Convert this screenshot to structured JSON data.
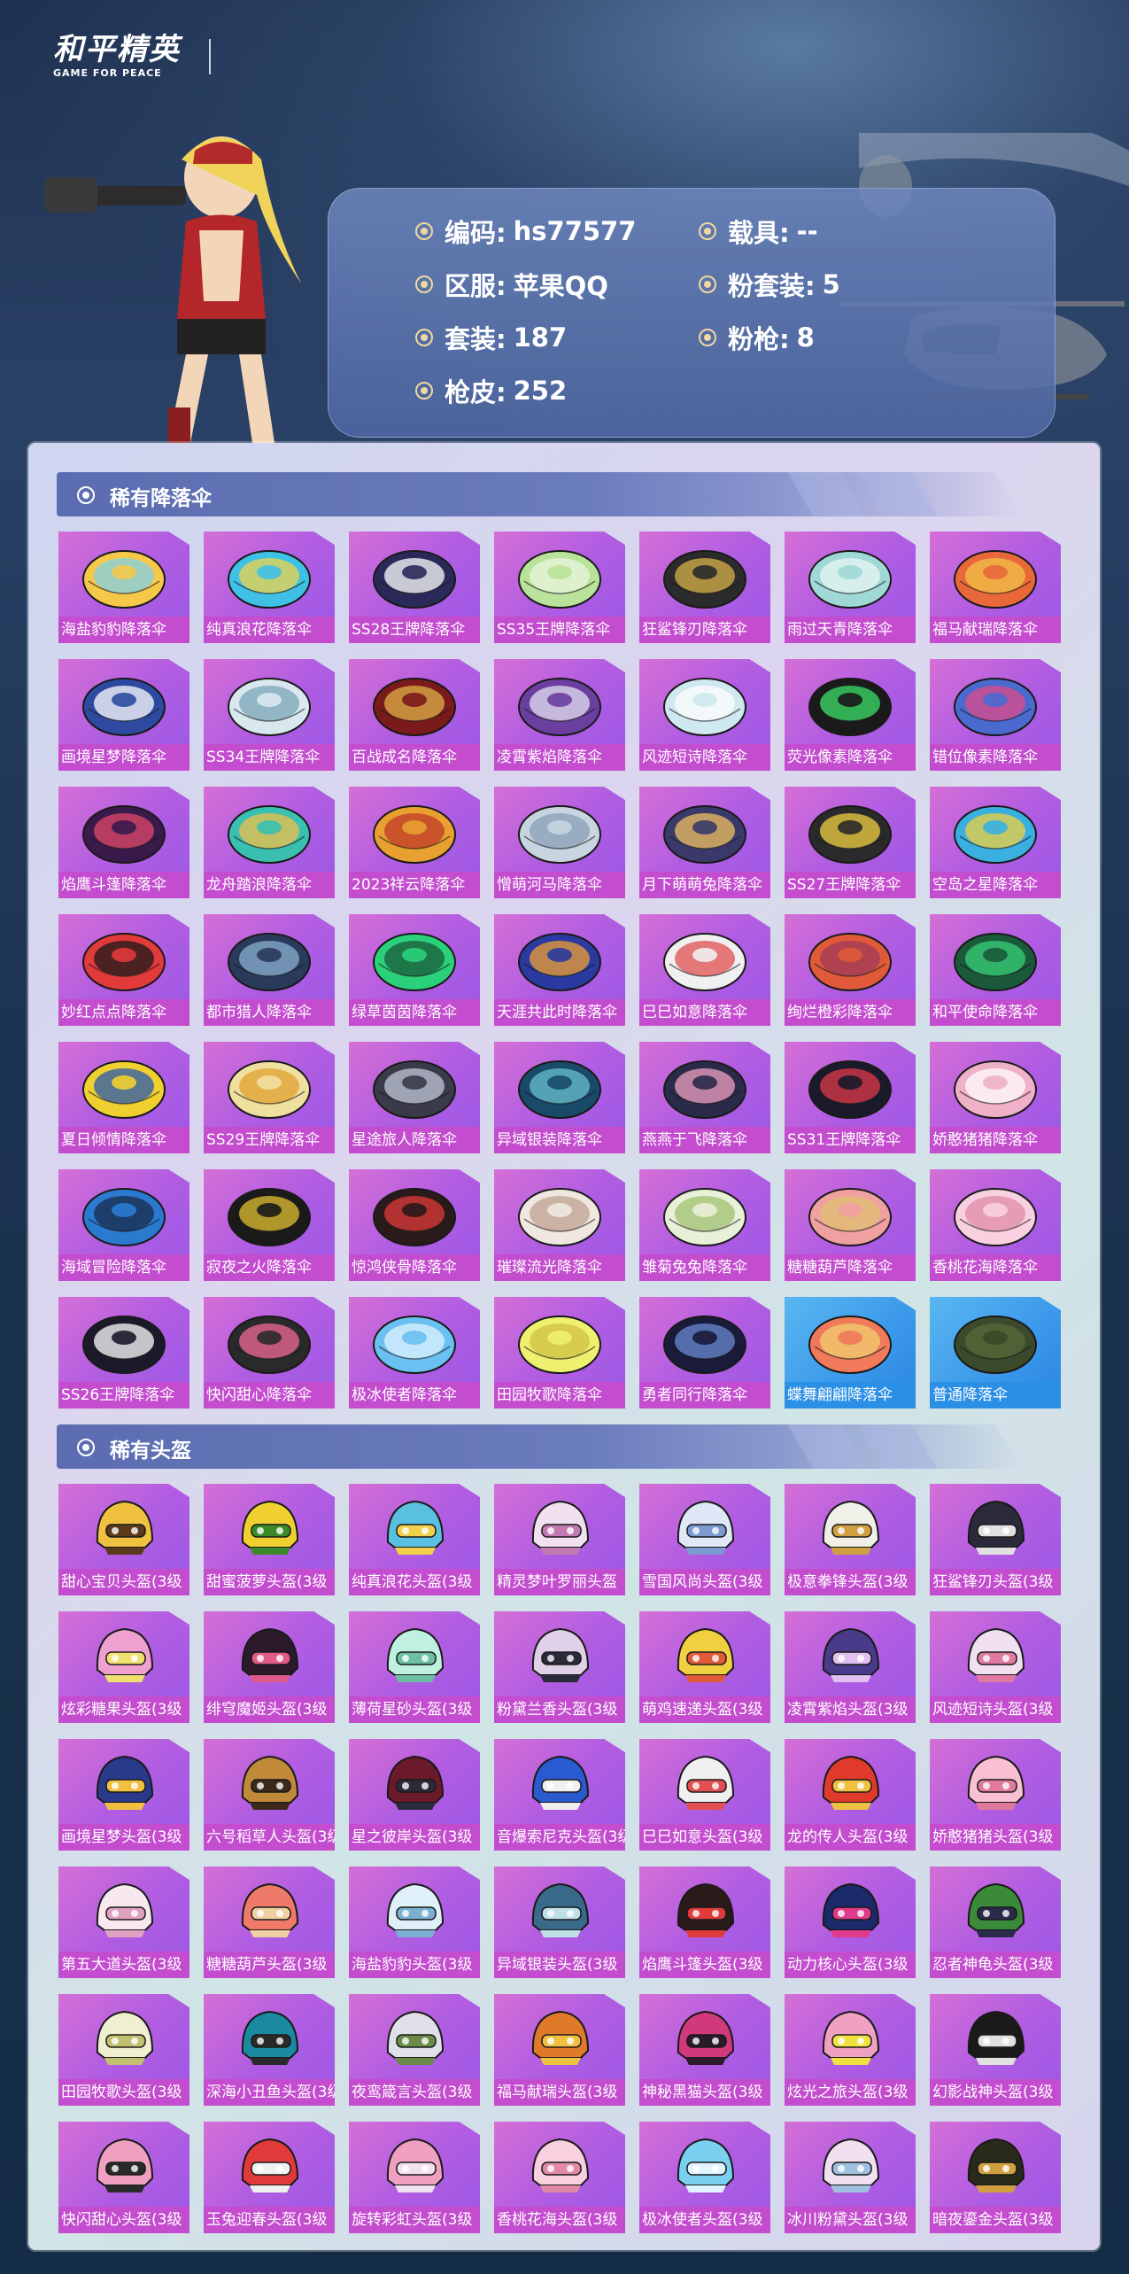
{
  "header": {
    "logo_cn": "和平精英",
    "logo_en": "GAME FOR PEACE"
  },
  "info": {
    "code_label": "编码:",
    "code_value": "hs77577",
    "vehicle_label": "载具:",
    "vehicle_value": "--",
    "server_label": "区服:",
    "server_value": "苹果QQ",
    "pink_suit_label": "粉套装:",
    "pink_suit_value": "5",
    "suit_label": "套装:",
    "suit_value": "187",
    "pink_gun_label": "粉枪:",
    "pink_gun_value": "8",
    "gun_skin_label": "枪皮:",
    "gun_skin_value": "252"
  },
  "colors": {
    "card_purple": "#b15de2",
    "card_label_purple": "#c44dcf",
    "card_blue": "#3a97ea",
    "section_bar": "#5b6cb0"
  },
  "sections": {
    "parachutes": {
      "title": "稀有降落伞",
      "items": [
        {
          "name": "海盐豹豹降落伞",
          "c1": "#f5c84a",
          "c2": "#7fd0e8"
        },
        {
          "name": "纯真浪花降落伞",
          "c1": "#3fc1e6",
          "c2": "#f0d34a"
        },
        {
          "name": "SS28王牌降落伞",
          "c1": "#2a2a5a",
          "c2": "#ffffff"
        },
        {
          "name": "SS35王牌降落伞",
          "c1": "#b9e39a",
          "c2": "#e9f5e0"
        },
        {
          "name": "狂鲨锋刃降落伞",
          "c1": "#2b2b2b",
          "c2": "#d8b24a"
        },
        {
          "name": "雨过天青降落伞",
          "c1": "#9fd8d6",
          "c2": "#e8f5f3"
        },
        {
          "name": "福马献瑞降落伞",
          "c1": "#e8683a",
          "c2": "#f3c14a"
        },
        {
          "name": "画境星梦降落伞",
          "c1": "#2d4aa0",
          "c2": "#ffffff"
        },
        {
          "name": "SS34王牌降落伞",
          "c1": "#d9e8ee",
          "c2": "#7aa6b7"
        },
        {
          "name": "百战成名降落伞",
          "c1": "#7a1a1a",
          "c2": "#e0b048"
        },
        {
          "name": "凌霄紫焰降落伞",
          "c1": "#6a3fa0",
          "c2": "#e6e0f0"
        },
        {
          "name": "风迹短诗降落伞",
          "c1": "#d0e8f0",
          "c2": "#ffffff"
        },
        {
          "name": "荧光像素降落伞",
          "c1": "#1a1a1a",
          "c2": "#3de06a"
        },
        {
          "name": "错位像素降落伞",
          "c1": "#4a6ad0",
          "c2": "#e04a8a"
        },
        {
          "name": "焰鹰斗篷降落伞",
          "c1": "#3a1a4a",
          "c2": "#e04a6a"
        },
        {
          "name": "龙舟踏浪降落伞",
          "c1": "#3ac0b0",
          "c2": "#f0c04a"
        },
        {
          "name": "2023祥云降落伞",
          "c1": "#e8a030",
          "c2": "#c03a2a"
        },
        {
          "name": "憎萌河马降落伞",
          "c1": "#c8d4e0",
          "c2": "#8aa0b8"
        },
        {
          "name": "月下萌萌兔降落伞",
          "c1": "#3a3a6a",
          "c2": "#f0c060"
        },
        {
          "name": "SS27王牌降落伞",
          "c1": "#2a2a2a",
          "c2": "#f0d040"
        },
        {
          "name": "空岛之星降落伞",
          "c1": "#3ab0e0",
          "c2": "#f0d040"
        },
        {
          "name": "妙红点点降落伞",
          "c1": "#e03a3a",
          "c2": "#1a1a1a"
        },
        {
          "name": "都市猎人降落伞",
          "c1": "#2a3a5a",
          "c2": "#8ab0d0"
        },
        {
          "name": "绿草茵茵降落伞",
          "c1": "#2ad07a",
          "c2": "#1a5a3a"
        },
        {
          "name": "天涯共此时降落伞",
          "c1": "#2a3aa0",
          "c2": "#f0a030"
        },
        {
          "name": "巳巳如意降落伞",
          "c1": "#f0f0f0",
          "c2": "#e05050"
        },
        {
          "name": "绚烂橙彩降落伞",
          "c1": "#e05a3a",
          "c2": "#a03a5a"
        },
        {
          "name": "和平使命降落伞",
          "c1": "#1a5a3a",
          "c2": "#3ad07a"
        },
        {
          "name": "夏日倾情降落伞",
          "c1": "#f0d030",
          "c2": "#2a5ab0"
        },
        {
          "name": "SS29王牌降落伞",
          "c1": "#f0e0a0",
          "c2": "#e0a030"
        },
        {
          "name": "星途旅人降落伞",
          "c1": "#3a3a4a",
          "c2": "#c0c8d8"
        },
        {
          "name": "异域银装降落伞",
          "c1": "#1a4a6a",
          "c2": "#6ac0d0"
        },
        {
          "name": "燕燕于飞降落伞",
          "c1": "#2a2a4a",
          "c2": "#f0a0c0"
        },
        {
          "name": "SS31王牌降落伞",
          "c1": "#1a1a2a",
          "c2": "#e03a4a"
        },
        {
          "name": "娇憨猪猪降落伞",
          "c1": "#f0b0c8",
          "c2": "#ffffff"
        },
        {
          "name": "海域冒险降落伞",
          "c1": "#2a7ad0",
          "c2": "#1a2a4a"
        },
        {
          "name": "寂夜之火降落伞",
          "c1": "#1a1a1a",
          "c2": "#e0c030"
        },
        {
          "name": "惊鸿侠骨降落伞",
          "c1": "#2a1a1a",
          "c2": "#e03a3a"
        },
        {
          "name": "璀璨流光降落伞",
          "c1": "#f0e8e0",
          "c2": "#c0a090"
        },
        {
          "name": "雏菊兔兔降落伞",
          "c1": "#e8f0d8",
          "c2": "#a0c070"
        },
        {
          "name": "糖糖葫芦降落伞",
          "c1": "#f0a0a0",
          "c2": "#e0c070"
        },
        {
          "name": "香桃花海降落伞",
          "c1": "#f8d0e0",
          "c2": "#e08aa8"
        },
        {
          "name": "SS26王牌降落伞",
          "c1": "#1a1a2a",
          "c2": "#ffffff"
        },
        {
          "name": "快闪甜心降落伞",
          "c1": "#2a2a2a",
          "c2": "#f06a9a"
        },
        {
          "name": "极冰使者降落伞",
          "c1": "#6ac0f0",
          "c2": "#e0f4ff"
        },
        {
          "name": "田园牧歌降落伞",
          "c1": "#f0f070",
          "c2": "#d0c040"
        },
        {
          "name": "勇者同行降落伞",
          "c1": "#1a1a3a",
          "c2": "#6a8ad0"
        },
        {
          "name": "蝶舞翩翩降落伞",
          "c1": "#f07a5a",
          "c2": "#f0d070",
          "blue": true
        },
        {
          "name": "普通降落伞",
          "c1": "#3a4a2a",
          "c2": "#5a6a3a",
          "blue": true
        }
      ]
    },
    "helmets": {
      "title": "稀有头盔",
      "items": [
        {
          "name": "甜心宝贝头盔(3级",
          "c1": "#f0c040",
          "c2": "#5a3a1a"
        },
        {
          "name": "甜蜜菠萝头盔(3级",
          "c1": "#f0d030",
          "c2": "#3a8a2a"
        },
        {
          "name": "纯真浪花头盔(3级",
          "c1": "#5ac0e0",
          "c2": "#f0d04a"
        },
        {
          "name": "精灵梦叶罗丽头盔",
          "c1": "#f0e0f0",
          "c2": "#c07ab0"
        },
        {
          "name": "雪国风尚头盔(3级",
          "c1": "#e0e8f8",
          "c2": "#7a9ad0"
        },
        {
          "name": "极意拳锋头盔(3级",
          "c1": "#f0f0e8",
          "c2": "#d0a040"
        },
        {
          "name": "狂鲨锋刃头盔(3级",
          "c1": "#2a2a3a",
          "c2": "#e0e0e0"
        },
        {
          "name": "炫彩糖果头盔(3级",
          "c1": "#f0a0d0",
          "c2": "#f0e070"
        },
        {
          "name": "绯穹魔姬头盔(3级",
          "c1": "#2a1a2a",
          "c2": "#e05a8a"
        },
        {
          "name": "薄荷星砂头盔(3级",
          "c1": "#c0f0e0",
          "c2": "#6ac0a0"
        },
        {
          "name": "粉黛兰香头盔(3级",
          "c1": "#e0d0e8",
          "c2": "#2a2a3a"
        },
        {
          "name": "萌鸡速递头盔(3级",
          "c1": "#f0d040",
          "c2": "#e05a3a"
        },
        {
          "name": "凌霄紫焰头盔(3级",
          "c1": "#4a3a8a",
          "c2": "#e0c0f0"
        },
        {
          "name": "风迹短诗头盔(3级",
          "c1": "#f0e0f0",
          "c2": "#e07aa0"
        },
        {
          "name": "画境星梦头盔(3级",
          "c1": "#2a3a8a",
          "c2": "#f0c040"
        },
        {
          "name": "六号稻草人头盔(3级",
          "c1": "#c08a3a",
          "c2": "#3a2a1a"
        },
        {
          "name": "星之彼岸头盔(3级",
          "c1": "#6a1a2a",
          "c2": "#2a2a3a"
        },
        {
          "name": "音爆索尼克头盔(3级",
          "c1": "#2a5ad0",
          "c2": "#f0f0f0"
        },
        {
          "name": "巳巳如意头盔(3级",
          "c1": "#f0f0f0",
          "c2": "#e05050"
        },
        {
          "name": "龙的传人头盔(3级",
          "c1": "#e03a2a",
          "c2": "#f0c040"
        },
        {
          "name": "娇憨猪猪头盔(3级",
          "c1": "#f8c0d0",
          "c2": "#e07a9a"
        },
        {
          "name": "第五大道头盔(3级",
          "c1": "#f8e8f0",
          "c2": "#e0a0c0"
        },
        {
          "name": "糖糖葫芦头盔(3级",
          "c1": "#f07a6a",
          "c2": "#f0d0a0"
        },
        {
          "name": "海盐豹豹头盔(3级",
          "c1": "#e0f0f8",
          "c2": "#7ab0d0"
        },
        {
          "name": "异域银装头盔(3级",
          "c1": "#3a6a8a",
          "c2": "#c0e0e8"
        },
        {
          "name": "焰鹰斗篷头盔(3级",
          "c1": "#2a1a1a",
          "c2": "#e03a3a"
        },
        {
          "name": "动力核心头盔(3级",
          "c1": "#1a2a6a",
          "c2": "#e03a8a"
        },
        {
          "name": "忍者神龟头盔(3级",
          "c1": "#3a8a3a",
          "c2": "#2a2a4a"
        },
        {
          "name": "田园牧歌头盔(3级",
          "c1": "#f0f0d0",
          "c2": "#c0c070"
        },
        {
          "name": "深海小丑鱼头盔(3级",
          "c1": "#1a8aa0",
          "c2": "#2a2a2a"
        },
        {
          "name": "夜鸾箴言头盔(3级",
          "c1": "#e0e0e8",
          "c2": "#6a8a4a"
        },
        {
          "name": "福马献瑞头盔(3级",
          "c1": "#e07a2a",
          "c2": "#f0c040"
        },
        {
          "name": "神秘黑猫头盔(3级",
          "c1": "#d03a7a",
          "c2": "#2a1a2a"
        },
        {
          "name": "炫光之旅头盔(3级",
          "c1": "#f0a0c0",
          "c2": "#f0e040"
        },
        {
          "name": "幻影战神头盔(3级",
          "c1": "#1a1a1a",
          "c2": "#e0e0e0"
        },
        {
          "name": "快闪甜心头盔(3级",
          "c1": "#f0a0c0",
          "c2": "#2a2a2a"
        },
        {
          "name": "玉兔迎春头盔(3级",
          "c1": "#e03a3a",
          "c2": "#f0f0f0"
        },
        {
          "name": "旋转彩虹头盔(3级",
          "c1": "#f0a0c0",
          "c2": "#f0e0f0"
        },
        {
          "name": "香桃花海头盔(3级",
          "c1": "#f8d0e0",
          "c2": "#e08aa8"
        },
        {
          "name": "极冰使者头盔(3级",
          "c1": "#7ad0f0",
          "c2": "#e0f4ff"
        },
        {
          "name": "冰川粉黛头盔(3级",
          "c1": "#f0e0f0",
          "c2": "#a0c0e0"
        },
        {
          "name": "暗夜鎏金头盔(3级",
          "c1": "#2a2a1a",
          "c2": "#d0a040"
        }
      ]
    }
  }
}
